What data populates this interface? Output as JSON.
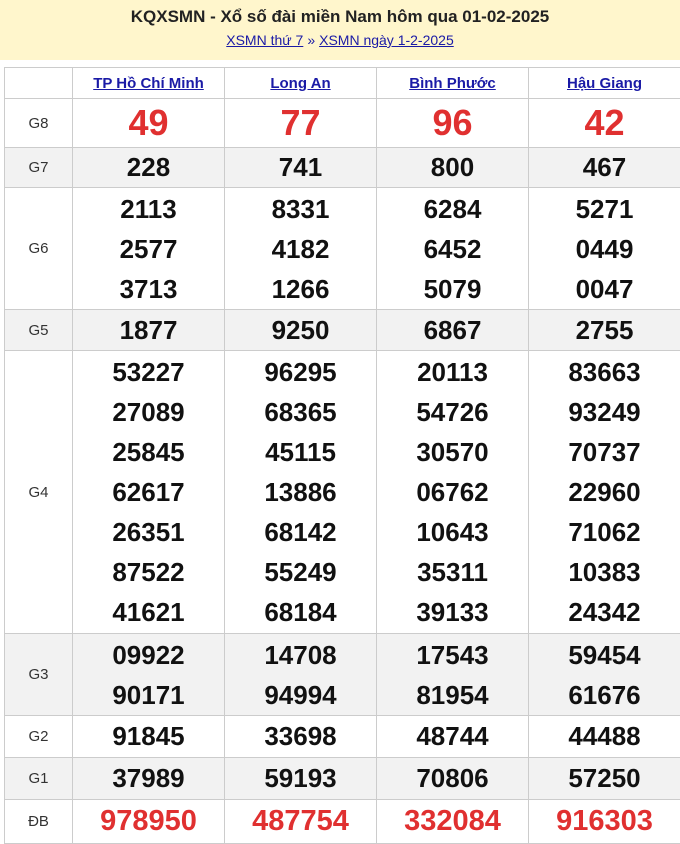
{
  "header": {
    "title": "KQXSMN - Xổ số đài miền Nam hôm qua 01-02-2025",
    "link1": "XSMN thứ 7",
    "separator": "»",
    "link2": "XSMN ngày 1-2-2025"
  },
  "provinces": [
    "TP Hồ Chí Minh",
    "Long An",
    "Bình Phước",
    "Hậu Giang"
  ],
  "rows": [
    {
      "label": "G8",
      "values": [
        [
          "49"
        ],
        [
          "77"
        ],
        [
          "96"
        ],
        [
          "42"
        ]
      ]
    },
    {
      "label": "G7",
      "values": [
        [
          "228"
        ],
        [
          "741"
        ],
        [
          "800"
        ],
        [
          "467"
        ]
      ]
    },
    {
      "label": "G6",
      "values": [
        [
          "2113",
          "2577",
          "3713"
        ],
        [
          "8331",
          "4182",
          "1266"
        ],
        [
          "6284",
          "6452",
          "5079"
        ],
        [
          "5271",
          "0449",
          "0047"
        ]
      ]
    },
    {
      "label": "G5",
      "values": [
        [
          "1877"
        ],
        [
          "9250"
        ],
        [
          "6867"
        ],
        [
          "2755"
        ]
      ]
    },
    {
      "label": "G4",
      "values": [
        [
          "53227",
          "27089",
          "25845",
          "62617",
          "26351",
          "87522",
          "41621"
        ],
        [
          "96295",
          "68365",
          "45115",
          "13886",
          "68142",
          "55249",
          "68184"
        ],
        [
          "20113",
          "54726",
          "30570",
          "06762",
          "10643",
          "35311",
          "39133"
        ],
        [
          "83663",
          "93249",
          "70737",
          "22960",
          "71062",
          "10383",
          "24342"
        ]
      ]
    },
    {
      "label": "G3",
      "values": [
        [
          "09922",
          "90171"
        ],
        [
          "14708",
          "94994"
        ],
        [
          "17543",
          "81954"
        ],
        [
          "59454",
          "61676"
        ]
      ]
    },
    {
      "label": "G2",
      "values": [
        [
          "91845"
        ],
        [
          "33698"
        ],
        [
          "48744"
        ],
        [
          "44488"
        ]
      ]
    },
    {
      "label": "G1",
      "values": [
        [
          "37989"
        ],
        [
          "59193"
        ],
        [
          "70806"
        ],
        [
          "57250"
        ]
      ]
    },
    {
      "label": "ĐB",
      "values": [
        [
          "978950"
        ],
        [
          "487754"
        ],
        [
          "332084"
        ],
        [
          "916303"
        ]
      ]
    }
  ]
}
